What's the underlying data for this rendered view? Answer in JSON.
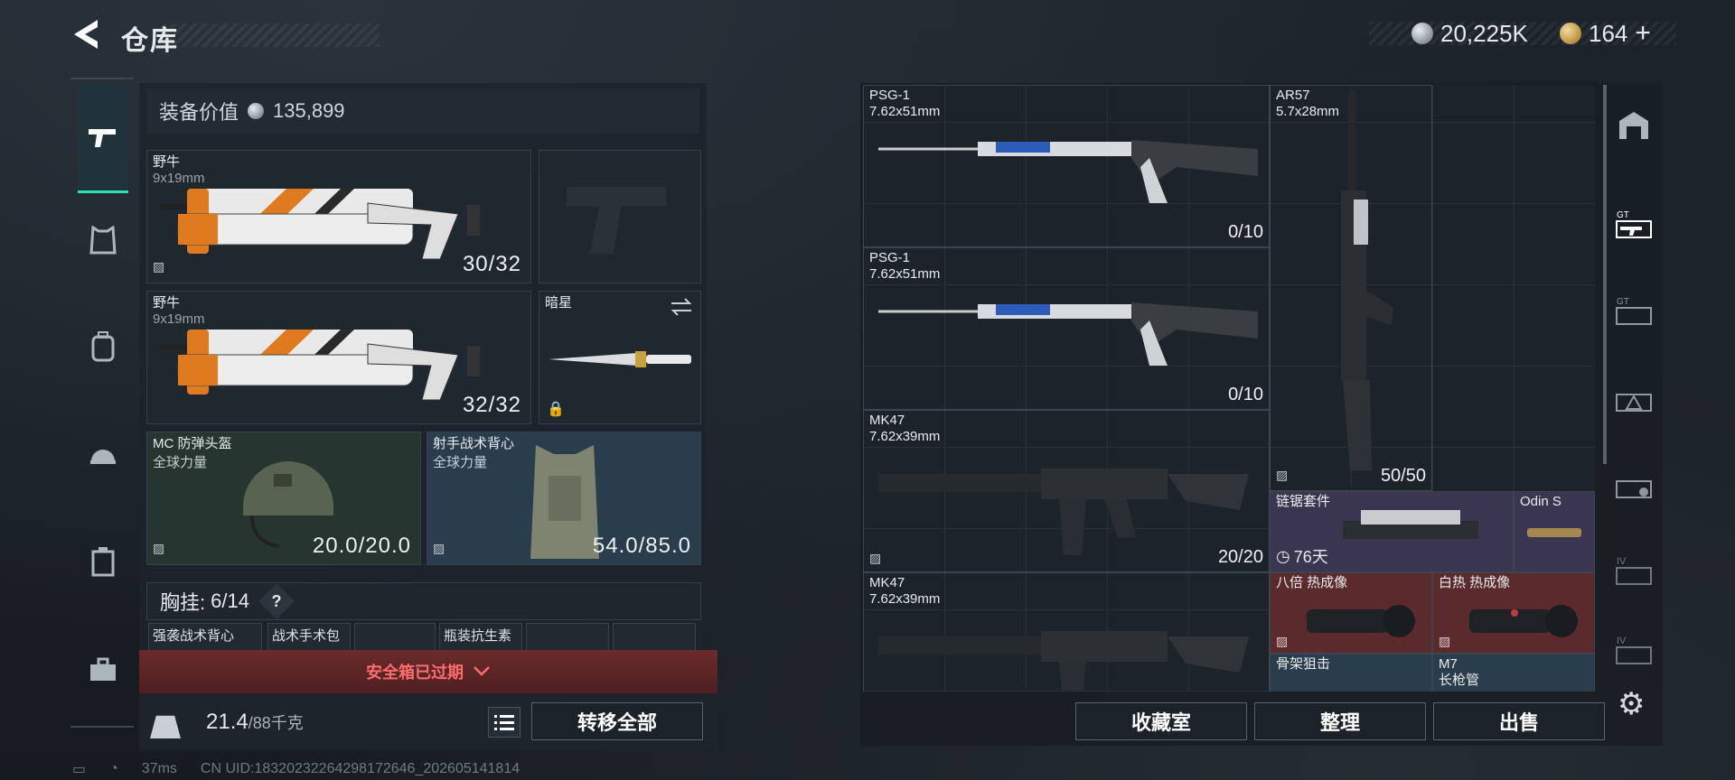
{
  "header": {
    "title": "仓库",
    "silver_amount": "20,225K",
    "gold_amount": "164",
    "gold_add": "+"
  },
  "equipment_value": {
    "label": "装备价值",
    "value": "135,899"
  },
  "loadout": {
    "primary1": {
      "name": "野牛",
      "caliber": "9x19mm",
      "ammo": "30/32"
    },
    "primary2": {
      "name": "野牛",
      "caliber": "9x19mm",
      "ammo": "32/32"
    },
    "melee": {
      "name": "暗星"
    },
    "helmet": {
      "name": "MC 防弹头盔",
      "sub": "全球力量",
      "durability": "20.0/20.0"
    },
    "armor": {
      "name": "射手战术背心",
      "sub": "全球力量",
      "durability": "54.0/85.0"
    }
  },
  "chest_rig": {
    "label": "胸挂:",
    "value": "6/14",
    "help": "?"
  },
  "small_slots": [
    "强袭战术背心",
    "战术手术包",
    "瓶装抗生素"
  ],
  "alert": {
    "text": "安全箱已过期"
  },
  "weight": {
    "value": "21.4",
    "max": "/88千克"
  },
  "transfer_button": "转移全部",
  "right_items": [
    {
      "name": "PSG-1",
      "caliber": "7.62x51mm",
      "count": "0/10"
    },
    {
      "name": "PSG-1",
      "caliber": "7.62x51mm",
      "count": "0/10"
    },
    {
      "name": "MK47",
      "caliber": "7.62x39mm",
      "count": "20/20"
    },
    {
      "name": "MK47",
      "caliber": "7.62x39mm",
      "count": ""
    },
    {
      "name": "AR57",
      "caliber": "5.7x28mm",
      "count": "50/50"
    },
    {
      "name": "链锯套件",
      "timer": "76天"
    },
    {
      "name": "Odin S"
    },
    {
      "name": "八倍 热成像"
    },
    {
      "name": "白热 热成像"
    },
    {
      "name": "骨架狙击"
    },
    {
      "name": "M7",
      "sub": "长枪管"
    }
  ],
  "bottom_buttons": {
    "collection": "收藏室",
    "organize": "整理",
    "sell": "出售"
  },
  "status_bar": {
    "ping": "37ms",
    "uid": "CN UID:1832023226429817264​6_202605141814"
  },
  "icons": [
    "back-arrow-icon",
    "silver-coin-icon",
    "gold-coin-icon",
    "gun-icon",
    "vest-icon",
    "backpack-icon",
    "helmet-icon",
    "case-icon",
    "toolbox-icon",
    "lock-icon",
    "list-icon",
    "gear-icon",
    "clock-icon",
    "swap-icon"
  ]
}
